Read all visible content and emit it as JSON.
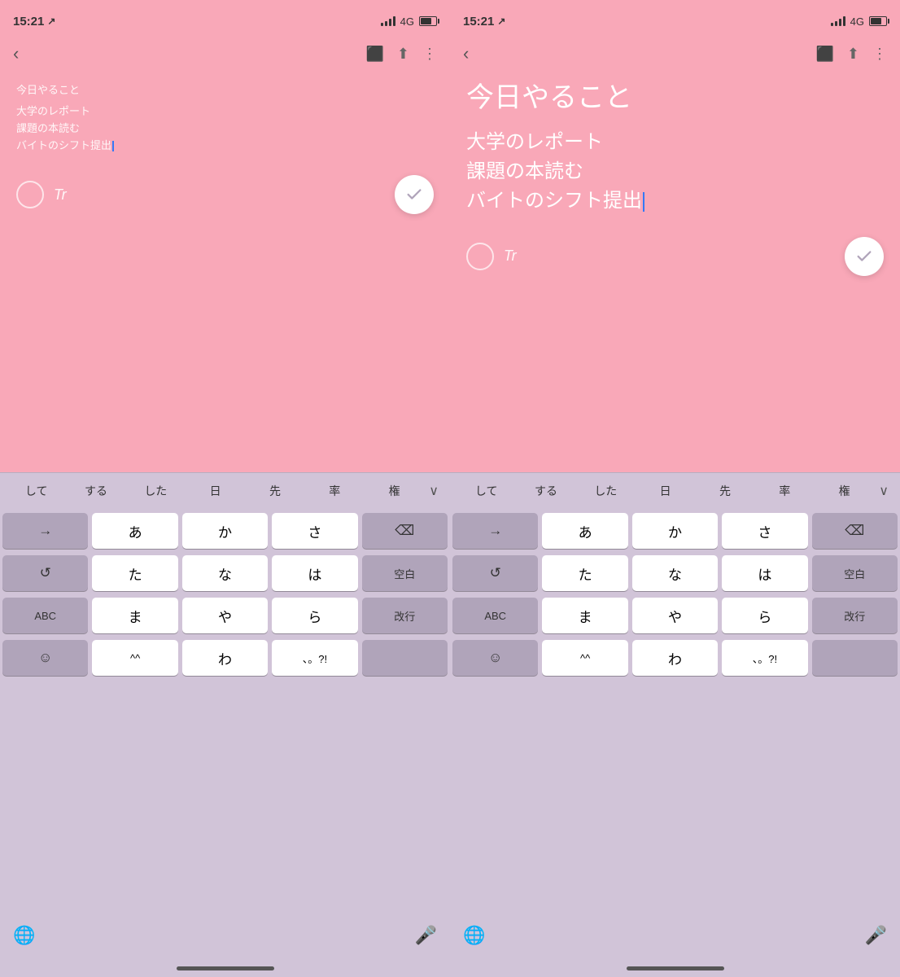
{
  "left": {
    "statusBar": {
      "time": "15:21",
      "signal": "4G",
      "hasBattery": true
    },
    "toolbar": {
      "backLabel": "‹",
      "deleteIcon": "🗑",
      "shareIcon": "↑",
      "moreIcon": "⋮"
    },
    "note": {
      "title": "今日やること",
      "body": "大学のレポート\n課題の本読む\nバイトのシフト提出",
      "cursorVisible": true,
      "fontSize": "small"
    },
    "bottomBar": {
      "circleLabel": "",
      "trLabel": "Tr",
      "checkLabel": "✓"
    },
    "suggestions": [
      "して",
      "する",
      "した",
      "日",
      "先",
      "率",
      "権"
    ],
    "keyboard": {
      "rows": [
        [
          "→",
          "あ",
          "か",
          "さ",
          "⌫"
        ],
        [
          "↩",
          "た",
          "な",
          "は",
          "空白"
        ],
        [
          "ABC",
          "ま",
          "や",
          "ら",
          "改行"
        ],
        [
          "☺",
          "^^",
          "わ",
          "、。?!",
          ""
        ]
      ]
    }
  },
  "right": {
    "statusBar": {
      "time": "15:21",
      "signal": "4G",
      "hasBattery": true
    },
    "toolbar": {
      "backLabel": "‹",
      "deleteIcon": "🗑",
      "shareIcon": "↑",
      "moreIcon": "⋮"
    },
    "note": {
      "title": "今日やること",
      "body": "大学のレポート\n課題の本読む\nバイトのシフト提出",
      "cursorVisible": true,
      "fontSize": "large"
    },
    "bottomBar": {
      "circleLabel": "",
      "trLabel": "Tr",
      "checkLabel": "✓"
    },
    "suggestions": [
      "して",
      "する",
      "した",
      "日",
      "先",
      "率",
      "権"
    ],
    "keyboard": {
      "rows": [
        [
          "→",
          "あ",
          "か",
          "さ",
          "⌫"
        ],
        [
          "↩",
          "た",
          "な",
          "は",
          "空白"
        ],
        [
          "ABC",
          "ま",
          "や",
          "ら",
          "改行"
        ],
        [
          "☺",
          "^^",
          "わ",
          "、。?!",
          ""
        ]
      ]
    }
  }
}
